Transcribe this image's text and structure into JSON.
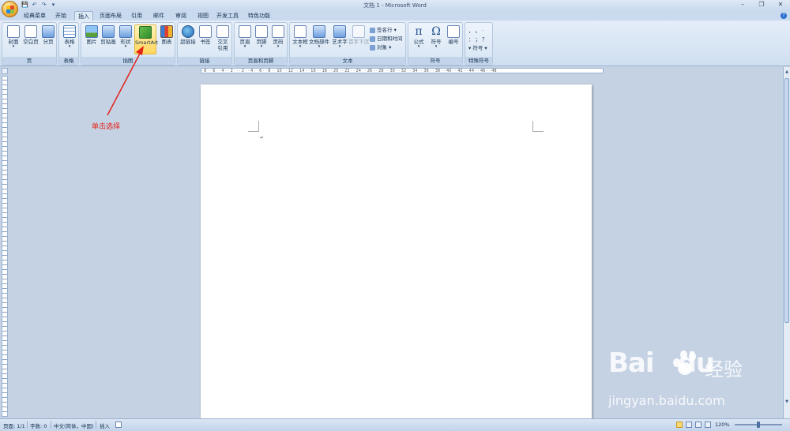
{
  "window": {
    "title": "文档 1 - Microsoft Word",
    "minimize": "–",
    "restore": "❐",
    "close": "✕"
  },
  "qat": [
    "💾",
    "↶",
    "↷",
    "▾"
  ],
  "tabs": [
    {
      "label": "经典菜单"
    },
    {
      "label": "开始"
    },
    {
      "label": "插入",
      "active": true
    },
    {
      "label": "页面布局"
    },
    {
      "label": "引用"
    },
    {
      "label": "邮件"
    },
    {
      "label": "审阅"
    },
    {
      "label": "视图"
    },
    {
      "label": "开发工具"
    },
    {
      "label": "特色功能"
    }
  ],
  "ribbon": {
    "groups": {
      "pages": {
        "label": "页",
        "buttons": [
          "封面",
          "空白页",
          "分页"
        ]
      },
      "tables": {
        "label": "表格",
        "buttons": [
          "表格"
        ]
      },
      "illustrations": {
        "label": "插图",
        "buttons": [
          "图片",
          "剪贴画",
          "形状",
          "SmartArt",
          "图表"
        ]
      },
      "links": {
        "label": "链接",
        "buttons": [
          "超链接",
          "书签",
          "交叉",
          "引用"
        ]
      },
      "header_footer": {
        "label": "页眉和页脚",
        "buttons": [
          "页眉",
          "页脚",
          "页码"
        ]
      },
      "text": {
        "label": "文本",
        "buttons": [
          "文本框",
          "文档部件",
          "艺术字",
          "首字下沉"
        ],
        "small": [
          "签名行 ▾",
          "日期和时间",
          "对象 ▾"
        ]
      },
      "symbols": {
        "label": "符号",
        "buttons": [
          "公式",
          "符号",
          "编号"
        ]
      },
      "special": {
        "label": "特殊符号",
        "rows": [
          "，  。  ·",
          "：  ；  ？",
          "▾ 符号 ▾"
        ]
      }
    }
  },
  "ruler_text": "· 8 ·  · 6 ·  · 4 ·  · 2 ·  ·  · 2 ·  · 4 ·  · 6 ·  · 8 ·  · 10 ·  · 12 ·  · 14 ·  · 16 ·  · 18 ·  · 20 ·  · 22 ·  · 24 ·  · 26 ·  · 28 ·  · 30 ·  · 32 ·  · 34 ·  · 36 ·  · 38 ·  · 40 ·  · 42 ·  · 44 ·  · 46 ·  · 48",
  "document": {
    "paragraph_mark": "↵"
  },
  "annotation": {
    "text": "单击选择",
    "color": "#e2231a"
  },
  "statusbar": {
    "page": "页面: 1/1",
    "words": "字数: 0",
    "language": "中文(简体，中国)",
    "mode": "插入",
    "zoom": "120%"
  },
  "watermark": {
    "brand": "Bai",
    "brand2": "du",
    "cn": "经验",
    "url": "jingyan.baidu.com"
  }
}
